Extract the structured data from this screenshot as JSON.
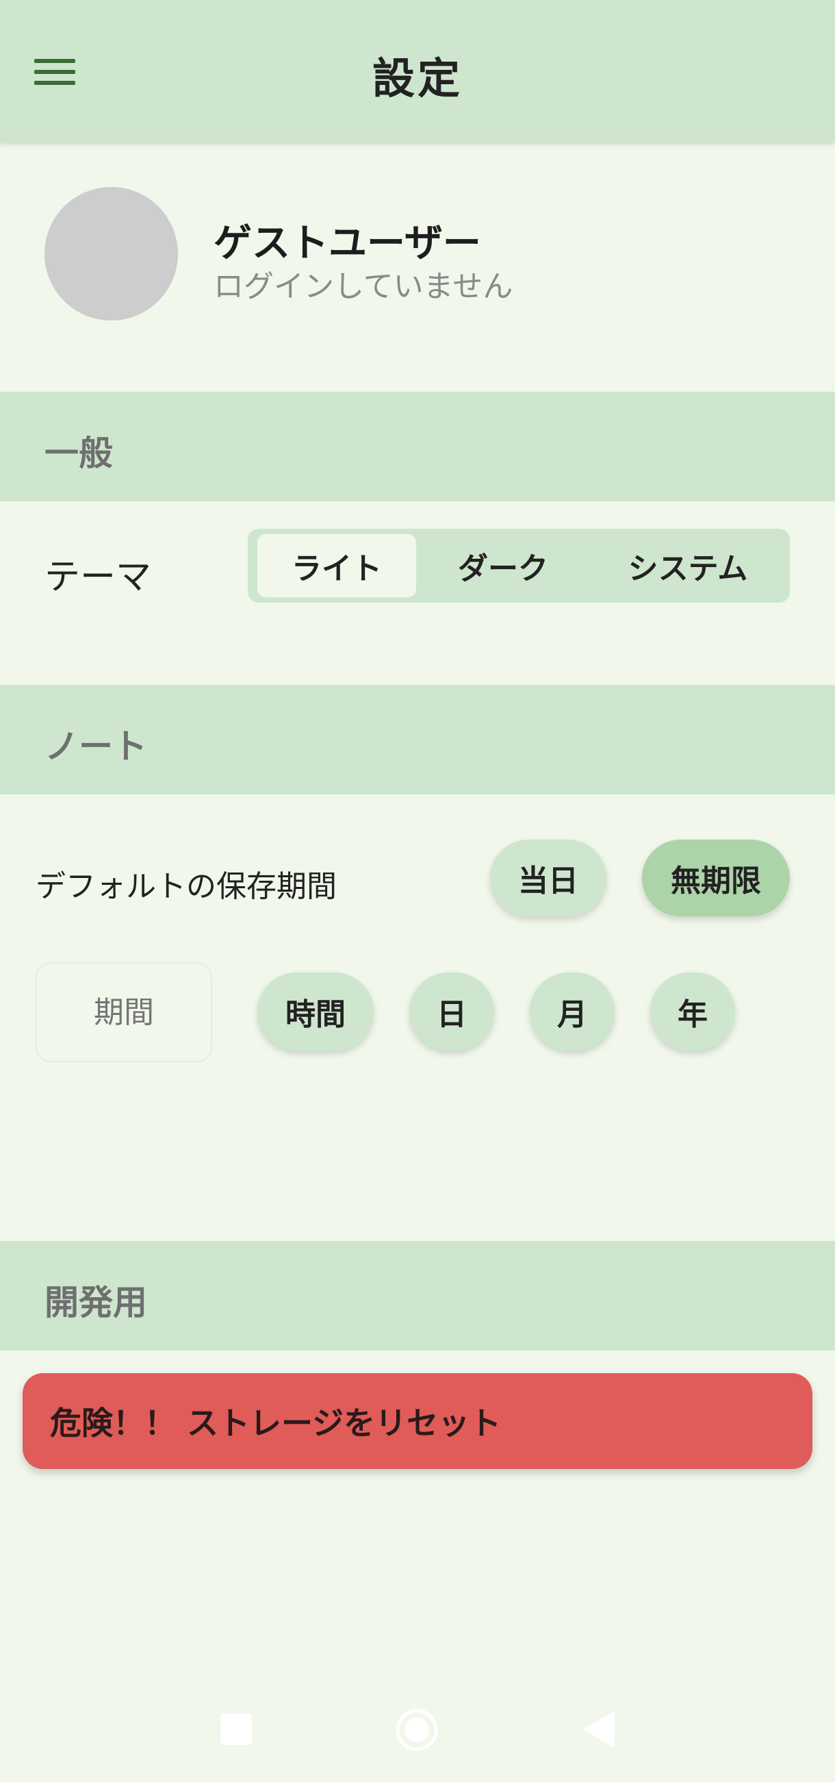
{
  "header": {
    "title": "設定",
    "menu_icon": "hamburger-menu-icon"
  },
  "profile": {
    "name": "ゲストユーザー",
    "status": "ログインしていません"
  },
  "sections": {
    "general": "一般",
    "note": "ノート",
    "dev": "開発用"
  },
  "theme": {
    "label": "テーマ",
    "options": [
      "ライト",
      "ダーク",
      "システム"
    ],
    "selected": "ライト"
  },
  "retention": {
    "label": "デフォルトの保存期間",
    "options": [
      "当日",
      "無期限"
    ],
    "selected": "無期限",
    "period_placeholder": "期間",
    "units": [
      "時間",
      "日",
      "月",
      "年"
    ]
  },
  "dev": {
    "reset_label": "危険！！ ストレージをリセット"
  },
  "colors": {
    "background": "#f1f7eb",
    "header": "#cfe6ce",
    "chip_selected": "#acd4a8",
    "danger": "#df5c58",
    "menu_icon": "#3b6e34"
  },
  "system_nav": {
    "recent_icon": "square-recent-apps-icon",
    "home_icon": "circle-home-icon",
    "back_icon": "triangle-back-icon"
  }
}
